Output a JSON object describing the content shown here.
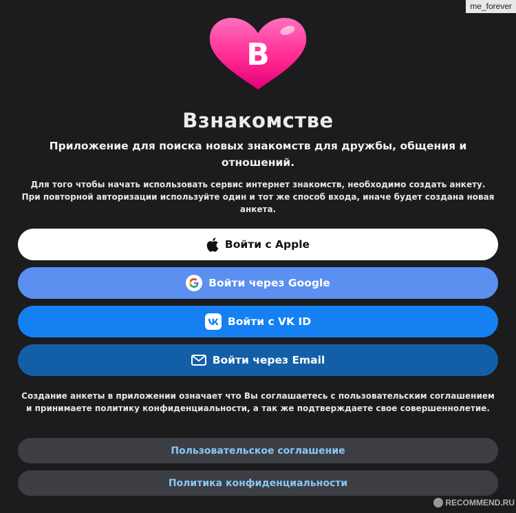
{
  "watermark": {
    "user": "me_forever",
    "site": "RECOMMEND.RU"
  },
  "logo": {
    "letter": "B",
    "icon": "heart-logo-icon",
    "color": "#ff1f8e"
  },
  "header": {
    "title": "Взнакомстве",
    "subtitle": "Приложение для поиска новых знакомств для дружбы, общения и отношений.",
    "info": "Для того чтобы начать использовать сервис интернет знакомств, необходимо создать анкету. При повторной авторизации используйте один и тот же способ входа, иначе будет создана новая анкета."
  },
  "auth": {
    "apple": {
      "label": "Войти с Apple",
      "icon": "apple-icon"
    },
    "google": {
      "label": "Войти через Google",
      "icon": "google-icon"
    },
    "vk": {
      "label": "Войти с VK ID",
      "icon": "vk-icon"
    },
    "email": {
      "label": "Войти через Email",
      "icon": "mail-icon"
    }
  },
  "consent": "Создание анкеты в приложении означает что Вы соглашаетесь с пользовательским соглашением и принимаете политику конфиденциальности, а так же подтверждаете свое совершеннолетие.",
  "links": {
    "terms": "Пользовательское соглашение",
    "privacy": "Политика конфиденциальности"
  },
  "colors": {
    "background": "#1c1c1e",
    "apple_button": "#ffffff",
    "google_button": "#5b8ff0",
    "vk_button": "#1480f2",
    "email_button": "#125fa8",
    "link_text": "#87c8f5"
  }
}
